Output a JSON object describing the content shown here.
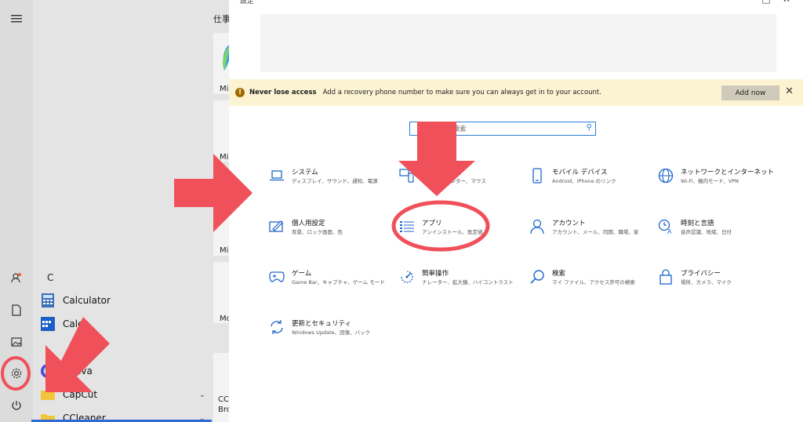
{
  "start_menu": {
    "section_letter": "C",
    "apps": [
      {
        "label": "Calculator",
        "icon": "calculator-icon"
      },
      {
        "label": "Calen",
        "icon": "calendar-icon"
      },
      {
        "label": "Canva",
        "icon": "canva-icon"
      },
      {
        "label": "CapCut",
        "icon": "folder-icon",
        "expandable": true
      },
      {
        "label": "CCleaner",
        "icon": "folder-icon",
        "expandable": true
      }
    ],
    "rail_icons": [
      "hamburger-menu-icon",
      "user-icon",
      "document-icon",
      "pictures-icon",
      "settings-gear-icon",
      "power-icon"
    ]
  },
  "tiles": {
    "group_title": "仕事",
    "labels": [
      "Mic",
      "Mic",
      "Mic",
      "Mo",
      "CClean",
      "Browse"
    ]
  },
  "settings": {
    "window_title": "設定",
    "notice": {
      "title": "Never lose access",
      "message": "Add a recovery phone number to make sure you can always get in to your account.",
      "action": "Add now",
      "close": "✕"
    },
    "search_placeholder": "の検索",
    "categories": [
      {
        "title": "システム",
        "subtitle": "ディスプレイ、サウンド、通知、電源",
        "icon": "laptop-icon"
      },
      {
        "title": "",
        "subtitle": "リンター、マウス",
        "icon": "devices-icon"
      },
      {
        "title": "モバイル デバイス",
        "subtitle": "Android、iPhone のリンク",
        "icon": "phone-icon"
      },
      {
        "title": "ネットワークとインターネット",
        "subtitle": "Wi-Fi、機内モード、VPN",
        "icon": "globe-icon"
      },
      {
        "title": "個人用設定",
        "subtitle": "背景、ロック画面、色",
        "icon": "personalization-icon"
      },
      {
        "title": "アプリ",
        "subtitle": "アンインストール、既定値",
        "icon": "apps-list-icon"
      },
      {
        "title": "アカウント",
        "subtitle": "アカウント、メール、同期、職場、家",
        "icon": "person-icon"
      },
      {
        "title": "時刻と言語",
        "subtitle": "音声認識、地域、日付",
        "icon": "time-language-icon"
      },
      {
        "title": "ゲーム",
        "subtitle": "Game Bar、キャプチャ、ゲーム モード",
        "icon": "gamepad-icon"
      },
      {
        "title": "簡単操作",
        "subtitle": "ナレーター、拡大鏡、ハイコントラスト",
        "icon": "ease-of-access-icon"
      },
      {
        "title": "検索",
        "subtitle": "マイ ファイル、アクセス許可の検索",
        "icon": "search-icon"
      },
      {
        "title": "プライバシー",
        "subtitle": "場所、カメラ、マイク",
        "icon": "lock-icon"
      },
      {
        "title": "更新とセキュリティ",
        "subtitle": "Windows Update、回復、バック",
        "icon": "update-icon"
      }
    ]
  },
  "colors": {
    "accent": "#1c66c8",
    "annotation_red": "#f0505a",
    "notice_bg": "#fbf3d2"
  }
}
